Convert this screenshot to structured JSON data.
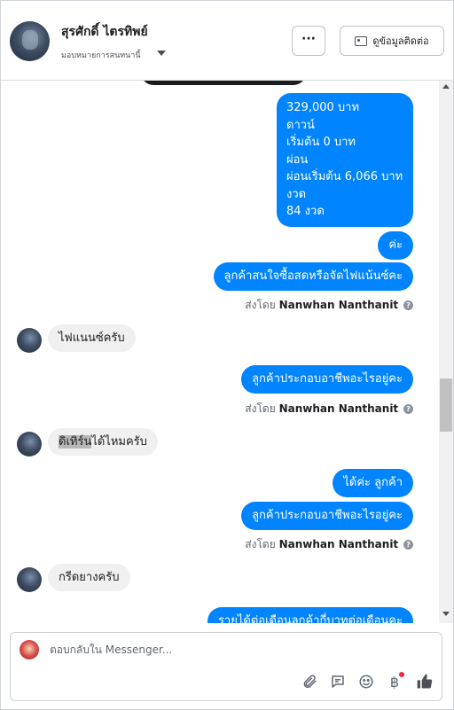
{
  "header": {
    "contact_name": "สุรศักดิ์ ไตรทิพย์",
    "assign_label": "มอบหมายการสนทนานี้",
    "more_label": "···",
    "view_contact_label": "ดูข้อมูลติดต่อ"
  },
  "messages": {
    "price_lines": [
      "329,000 บาท",
      "ดาวน์",
      "เริ่มต้น 0 บาท",
      "ผ่อน",
      "ผ่อนเริ่มต้น 6,066 บาท",
      "งวด",
      "84 งวด"
    ],
    "ka": "ค่ะ",
    "q_interest": "ลูกค้าสนใจซื้อสดหรือจัดไฟแน้นซ์คะ",
    "sent_by_label": "ส่งโดย",
    "sent_by_name": "Nanwhan Nanthanit",
    "reply_finance": "ไฟแนนซ์ครับ",
    "q_occupation_1": "ลูกค้าประกอบอาชีพอะไรอยู่คะ",
    "reply_can_prefix": "ดิเทิร์",
    "reply_can_hl": "น",
    "reply_can_suffix": "ได้ไหมครับ",
    "ok_customer": "ได้ค่ะ ลูกค้า",
    "q_occupation_2": "ลูกค้าประกอบอาชีพอะไรอยู่คะ",
    "reply_rubber": "กรีดยางครับ",
    "q_income_partial": "รายได้ต่อเดือนลูกค้ากี่บาทต่อเดือนคะ"
  },
  "composer": {
    "placeholder": "ตอบกลับใน Messenger..."
  },
  "icons": {
    "attach": "paperclip-icon",
    "saved_replies": "chat-bubble-icon",
    "emoji": "smiley-icon",
    "payment": "baht-icon",
    "like": "thumbs-up-icon"
  },
  "colors": {
    "outgoing_bubble": "#0084ff",
    "incoming_bubble": "#f1f0f0",
    "notification_dot": "#f02849"
  }
}
